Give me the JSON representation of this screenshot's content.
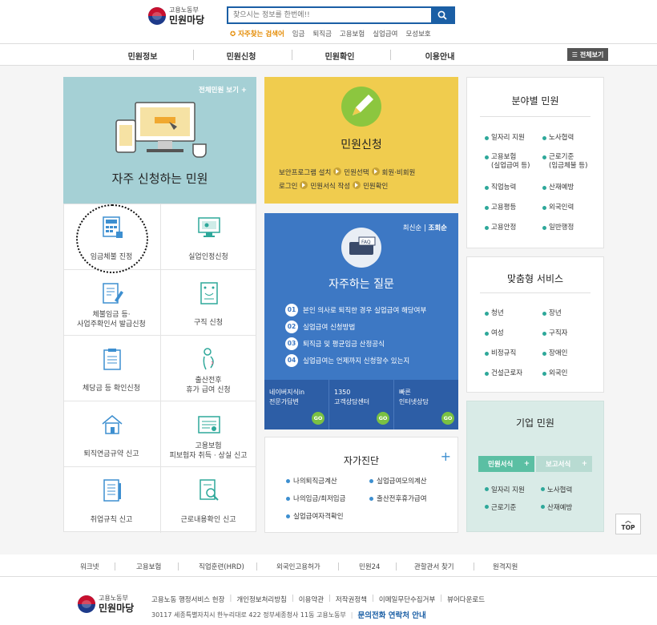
{
  "header": {
    "ministry": "고용노동부",
    "site_title": "민원마당",
    "search_placeholder": "찾으시는 정보를 한번에!!",
    "quick_label": "자주찾는 검색어",
    "quick_terms": [
      "임금",
      "퇴직금",
      "고용보험",
      "실업급여",
      "모성보호"
    ]
  },
  "gnb": {
    "items": [
      "민원정보",
      "민원신청",
      "민원확인",
      "이용안내"
    ],
    "all_menu": "전체보기"
  },
  "frequent": {
    "all_link": "전체민원 보기",
    "heading": "자주 신청하는 민원",
    "cells": [
      {
        "line1": "임금체불 진정",
        "line2": "",
        "icon": "calculator-icon"
      },
      {
        "line1": "실업인정신청",
        "line2": "",
        "icon": "monitor-icon"
      },
      {
        "line1": "체불임금 등·",
        "line2": "사업주확인서 발급신청",
        "icon": "document-pen-icon"
      },
      {
        "line1": "구직 신청",
        "line2": "",
        "icon": "resume-icon"
      },
      {
        "line1": "체당금 등 확인신청",
        "line2": "",
        "icon": "clipboard-icon"
      },
      {
        "line1": "출산전후",
        "line2": "휴가 급여 신청",
        "icon": "pregnant-icon"
      },
      {
        "line1": "퇴직연금규약 신고",
        "line2": "",
        "icon": "house-icon"
      },
      {
        "line1": "고용보험",
        "line2": "피보험자 취득 · 상실 신고",
        "icon": "certificate-icon"
      },
      {
        "line1": "취업규칙 신고",
        "line2": "",
        "icon": "rulebook-icon"
      },
      {
        "line1": "근로내용확인 신고",
        "line2": "",
        "icon": "magnifier-doc-icon"
      }
    ]
  },
  "apply": {
    "heading": "민원신청",
    "steps_line1": [
      "보안프로그램 설치",
      "민원선택",
      "회원·비회원"
    ],
    "steps_line2": [
      "로그인",
      "민원서식 작성",
      "민원확인"
    ]
  },
  "faq": {
    "sort_latest": "최신순",
    "sort_views": "조회순",
    "heading": "자주하는 질문",
    "items": [
      {
        "num": "01",
        "text": "본인 의사로 퇴직한 경우 실업급여 해당여부"
      },
      {
        "num": "02",
        "text": "실업급여 신청방법"
      },
      {
        "num": "03",
        "text": "퇴직금 및 평균임금 산정공식"
      },
      {
        "num": "04",
        "text": "실업급여는 언제까지 신청할수 있는지"
      }
    ],
    "contacts": [
      {
        "line1": "네이버지식in",
        "line2": "전문가답변",
        "go": "GO"
      },
      {
        "line1": "1350",
        "line2": "고객상담센터",
        "go": "GO"
      },
      {
        "line1": "빠른",
        "line2": "인터넷상담",
        "go": "GO"
      }
    ]
  },
  "diag": {
    "heading": "자가진단",
    "items": [
      "나의퇴직금계산",
      "실업급여모의계산",
      "나의임금/최저임금",
      "출산전후휴가급여",
      "실업급여자격확인"
    ]
  },
  "field": {
    "heading": "분야별 민원",
    "items": [
      {
        "l1": "일자리 지원",
        "l2": ""
      },
      {
        "l1": "노사협력",
        "l2": ""
      },
      {
        "l1": "고용보험",
        "l2": "(실업급여 등)"
      },
      {
        "l1": "근로기준",
        "l2": "(임금체불 등)"
      },
      {
        "l1": "직업능력",
        "l2": ""
      },
      {
        "l1": "산재예방",
        "l2": ""
      },
      {
        "l1": "고용평등",
        "l2": ""
      },
      {
        "l1": "외국인력",
        "l2": ""
      },
      {
        "l1": "고용안정",
        "l2": ""
      },
      {
        "l1": "일반행정",
        "l2": ""
      }
    ]
  },
  "custom": {
    "heading": "맞춤형 서비스",
    "items": [
      "청년",
      "장년",
      "여성",
      "구직자",
      "비정규직",
      "장애인",
      "건설근로자",
      "외국인"
    ]
  },
  "corp": {
    "heading": "기업 민원",
    "tab1": "민원서식",
    "tab2": "보고서식",
    "items": [
      "일자리 지원",
      "노사협력",
      "근로기준",
      "산재예방"
    ]
  },
  "top_button": "TOP",
  "footer_links": [
    "워크넷",
    "고용보험",
    "직업훈련(HRD)",
    "외국인고용허가",
    "민원24",
    "관할관서 찾기",
    "원격지원"
  ],
  "footer": {
    "ministry": "고용노동부",
    "title": "민원마당",
    "menu": [
      "고용노동 행정서비스 헌장",
      "개인정보처리방침",
      "이용약관",
      "저작권정책",
      "이메일무단수집거부",
      "뷰어다운로드"
    ],
    "address": "30117 세종특별자치시 한누리대로 422 정부세종청사 11동 고용노동부",
    "phone_guide": "문의전화 연락처 안내"
  },
  "colors": {
    "primary_blue": "#1b5fa5",
    "teal_panel": "#a5d0d5",
    "yellow_panel": "#f0cc4e",
    "faq_blue": "#3d78c4",
    "corp_green": "#d9ebe7"
  }
}
